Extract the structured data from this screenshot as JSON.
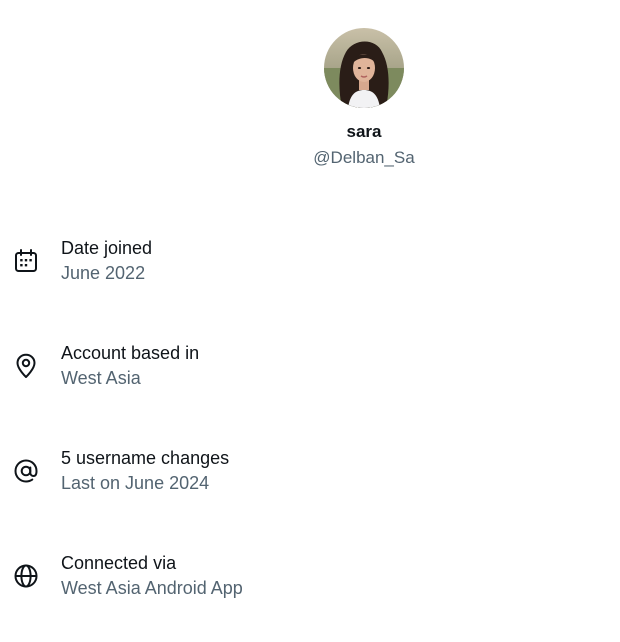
{
  "profile": {
    "display_name": "sara",
    "handle": "@Delban_Sa",
    "avatar_icon": "profile-photo"
  },
  "details": [
    {
      "icon": "calendar-icon",
      "title": "Date joined",
      "value": "June 2022"
    },
    {
      "icon": "location-pin-icon",
      "title": "Account based in",
      "value": "West Asia"
    },
    {
      "icon": "at-sign-icon",
      "title": "5 username changes",
      "value": "Last on June 2024"
    },
    {
      "icon": "globe-icon",
      "title": "Connected via",
      "value": "West Asia Android App"
    }
  ],
  "colors": {
    "primary_text": "#0f1419",
    "secondary_text": "#536471",
    "background": "#ffffff"
  }
}
